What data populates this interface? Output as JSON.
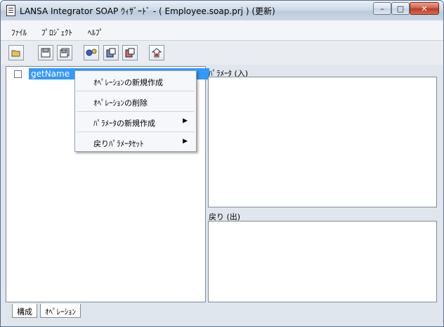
{
  "window": {
    "title": "LANSA Integrator SOAP ｳｨｻﾞｰﾄﾞ - ( Employee.soap.prj ) (更新)",
    "minimize": "–",
    "maximize": "□",
    "close": "✕"
  },
  "menu": {
    "items": [
      "ﾌｧｲﾙ",
      "ﾌﾟﾛｼﾞｪｸﾄ",
      "ﾍﾙﾌﾟ"
    ]
  },
  "toolbar": {
    "icons": [
      "open-folder-icon",
      "save-icon",
      "save-all-icon",
      "generate-icon",
      "add-operation-icon",
      "delete-operation-icon",
      "deploy-icon"
    ]
  },
  "tree": {
    "item_label": "getName"
  },
  "context_menu": {
    "items": [
      {
        "label": "ｵﾍﾟﾚｰｼｮﾝの新規作成",
        "submenu": false
      },
      {
        "label": "ｵﾍﾟﾚｰｼｮﾝの削除",
        "submenu": false
      },
      {
        "label": "ﾊﾟﾗﾒｰﾀの新規作成",
        "submenu": true
      },
      {
        "label": "戻りﾊﾟﾗﾒｰﾀｾｯﾄ",
        "submenu": true
      }
    ],
    "arrow": "▶"
  },
  "panels": {
    "params_in_label": "ﾊﾟﾗﾒｰﾀ (入)",
    "return_out_label": "戻り (出)"
  },
  "tabs": [
    "構成",
    "ｵﾍﾟﾚｰｼｮﾝ"
  ],
  "colors": {
    "selection": "#3399ff",
    "close_button": "#c9452c"
  }
}
